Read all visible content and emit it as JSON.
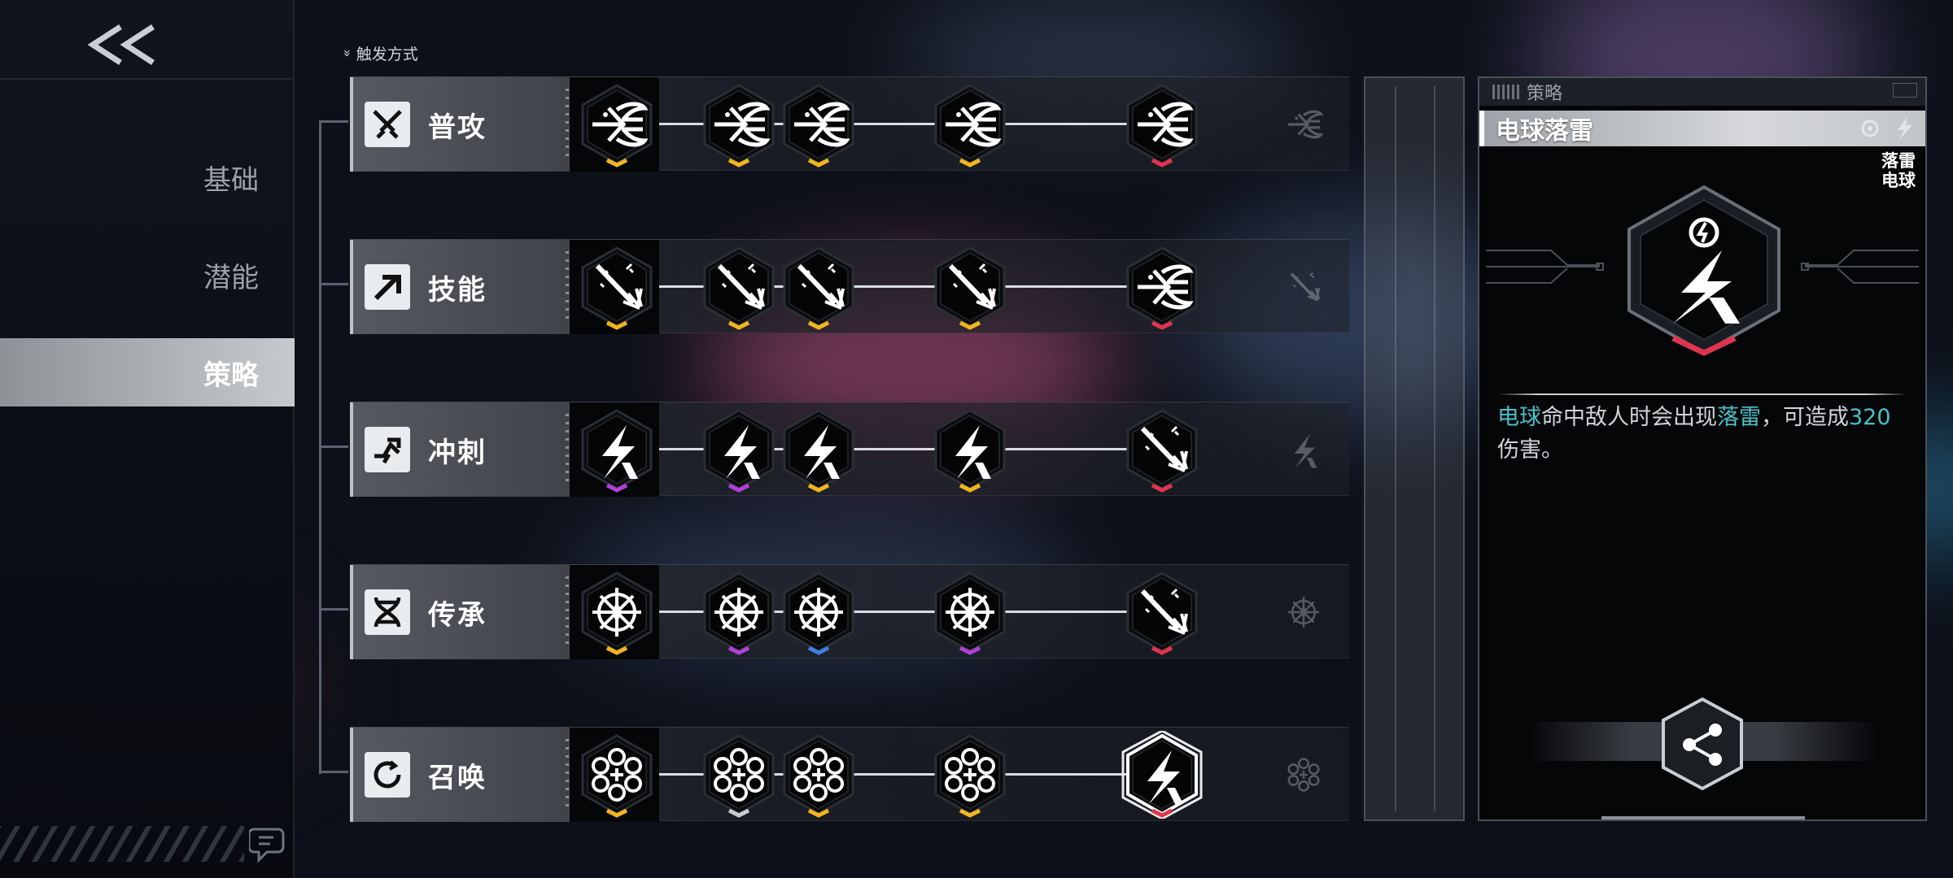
{
  "back": {
    "label": "<<"
  },
  "nav": {
    "items": [
      {
        "label": "基础",
        "active": false
      },
      {
        "label": "潜能",
        "active": false
      },
      {
        "label": "策略",
        "active": true
      }
    ]
  },
  "trigger_label": "触发方式",
  "rows": [
    {
      "name": "普攻",
      "icon": "crossed-swords-icon",
      "node_icon": "wing-burst-icon",
      "nodes": [
        {
          "icon": "wing-burst-icon",
          "tier": "gold"
        },
        {
          "icon": "wing-burst-icon",
          "tier": "gold"
        },
        {
          "icon": "wing-burst-icon",
          "tier": "gold"
        },
        {
          "icon": "wing-burst-icon",
          "tier": "gold"
        },
        {
          "icon": "wing-burst-icon",
          "tier": "red"
        }
      ]
    },
    {
      "name": "技能",
      "icon": "arrow-dash-icon",
      "node_icon": "spear-icon",
      "nodes": [
        {
          "icon": "spear-icon",
          "tier": "gold"
        },
        {
          "icon": "spear-icon",
          "tier": "gold"
        },
        {
          "icon": "spear-icon",
          "tier": "gold"
        },
        {
          "icon": "spear-icon",
          "tier": "gold"
        },
        {
          "icon": "wing-burst-icon",
          "tier": "red"
        }
      ]
    },
    {
      "name": "冲刺",
      "icon": "sprint-icon",
      "node_icon": "lightning-icon",
      "nodes": [
        {
          "icon": "lightning-icon",
          "tier": "purple"
        },
        {
          "icon": "lightning-icon",
          "tier": "purple"
        },
        {
          "icon": "lightning-icon",
          "tier": "gold"
        },
        {
          "icon": "lightning-icon",
          "tier": "gold"
        },
        {
          "icon": "spear-icon",
          "tier": "red"
        }
      ]
    },
    {
      "name": "传承",
      "icon": "dna-icon",
      "node_icon": "compass-star-icon",
      "nodes": [
        {
          "icon": "compass-star-icon",
          "tier": "gold"
        },
        {
          "icon": "compass-star-icon",
          "tier": "purple"
        },
        {
          "icon": "compass-star-icon",
          "tier": "blue"
        },
        {
          "icon": "compass-star-icon",
          "tier": "purple"
        },
        {
          "icon": "spear-icon",
          "tier": "red"
        }
      ]
    },
    {
      "name": "召唤",
      "icon": "swirl-icon",
      "node_icon": "flower-icon",
      "nodes": [
        {
          "icon": "flower-icon",
          "tier": "gold"
        },
        {
          "icon": "flower-icon",
          "tier": "white"
        },
        {
          "icon": "flower-icon",
          "tier": "gold"
        },
        {
          "icon": "flower-icon",
          "tier": "gold"
        },
        {
          "icon": "lightning-icon",
          "tier": "red",
          "selected": true
        }
      ]
    }
  ],
  "tier_colors": {
    "gold": "#f2b51e",
    "red": "#e0344f",
    "purple": "#b040d8",
    "blue": "#3e7fe0",
    "white": "#c8ccd2"
  },
  "detail": {
    "section_tag": "策略",
    "title": "电球落雷",
    "tags": [
      "落雷",
      "电球"
    ],
    "icon": "lightning-icon",
    "tier": "red",
    "desc_parts": [
      {
        "text": "电球",
        "hl": true
      },
      {
        "text": "命中敌人时会出现",
        "hl": false
      },
      {
        "text": "落雷",
        "hl": true
      },
      {
        "text": "，可造成",
        "hl": false
      },
      {
        "text": "320",
        "hl": true
      },
      {
        "text": "伤害。",
        "hl": false
      }
    ],
    "share_icon": "share-icon"
  }
}
